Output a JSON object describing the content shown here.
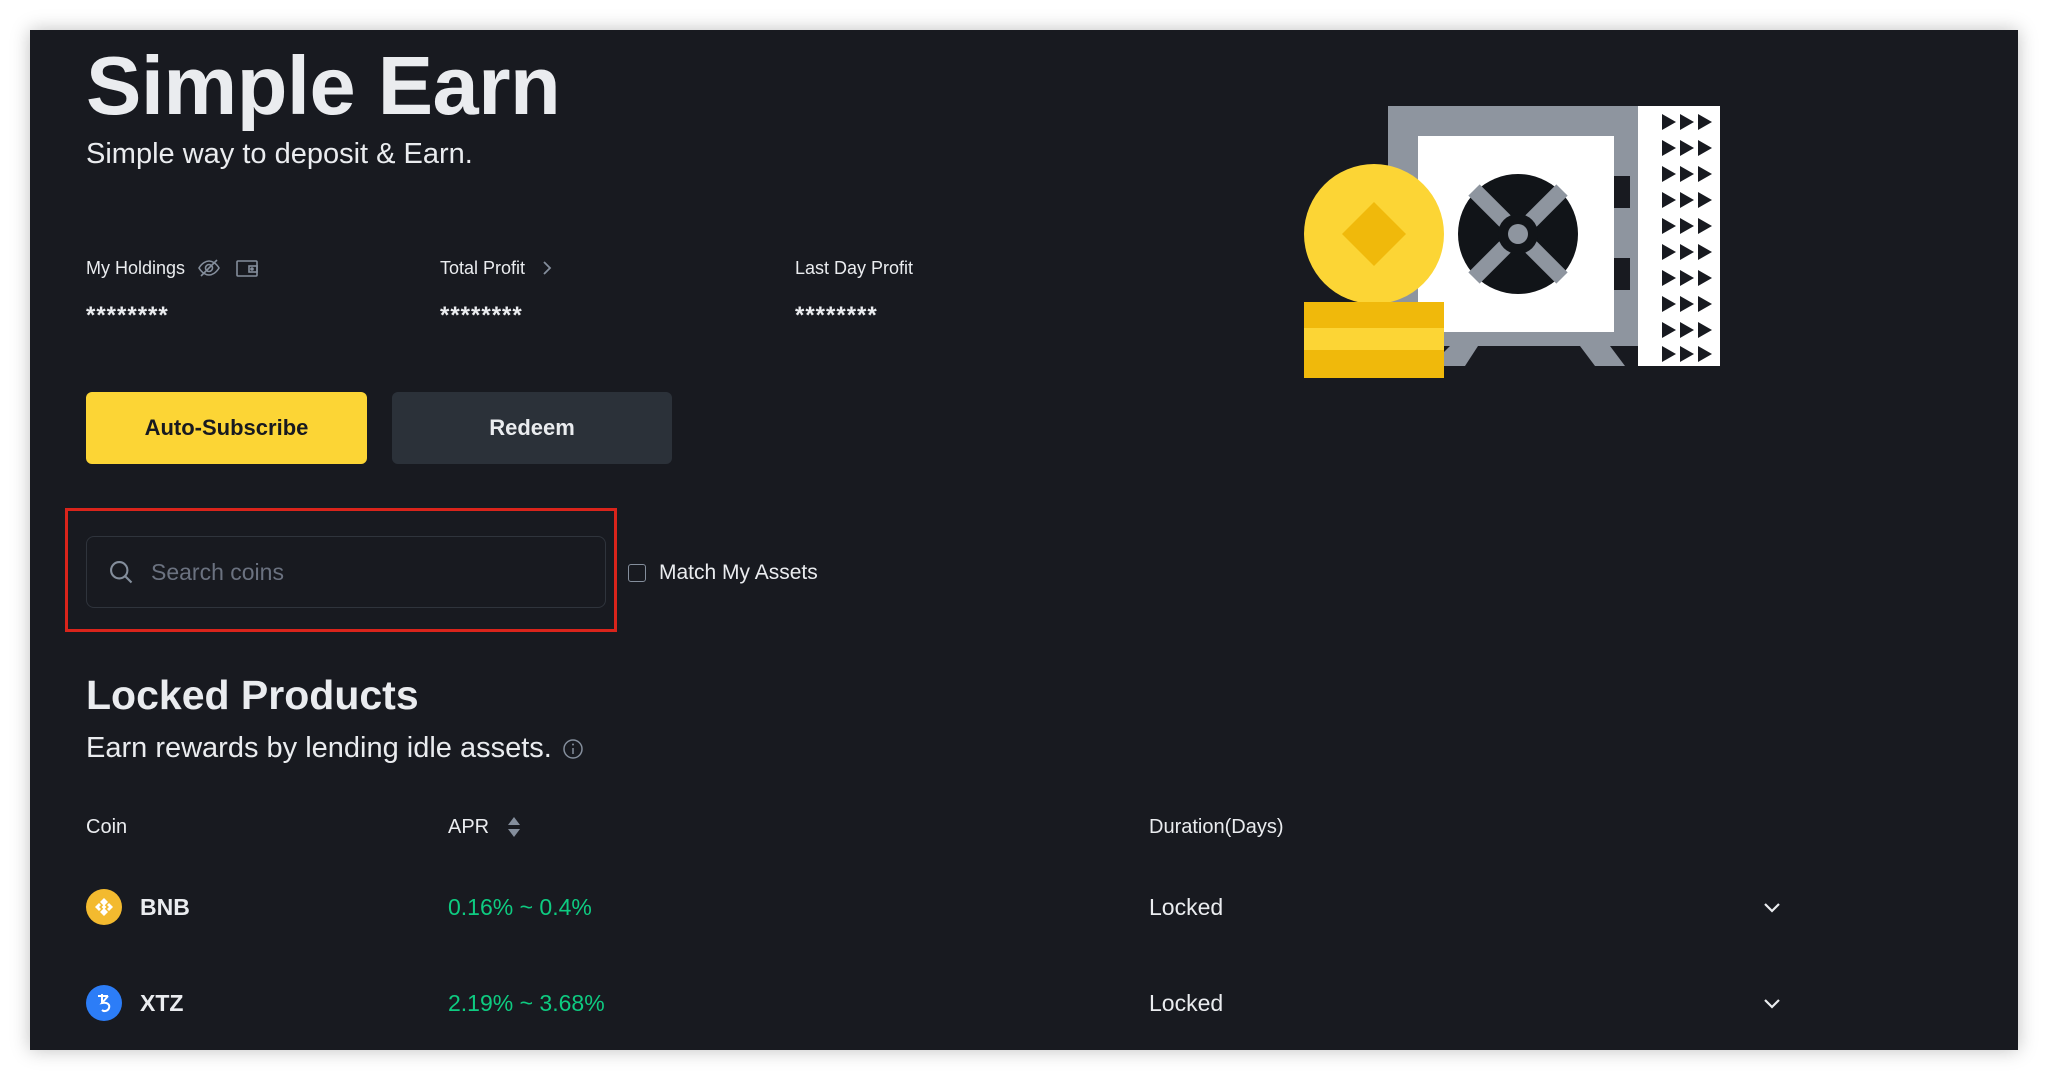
{
  "hero": {
    "title": "Simple Earn",
    "subtitle": "Simple way to deposit & Earn."
  },
  "stats": {
    "holdings": {
      "label": "My Holdings",
      "value": "********",
      "icons": [
        "eye-hidden-icon",
        "wallet-icon"
      ]
    },
    "total_profit": {
      "label": "Total Profit",
      "value": "********",
      "icons": [
        "chevron-right-icon"
      ]
    },
    "last_day_profit": {
      "label": "Last Day Profit",
      "value": "********"
    }
  },
  "actions": {
    "auto_subscribe": "Auto-Subscribe",
    "redeem": "Redeem"
  },
  "search": {
    "placeholder": "Search coins",
    "value": "",
    "match_assets_label": "Match My Assets",
    "match_assets_checked": false
  },
  "locked_products": {
    "title": "Locked Products",
    "subtitle": "Earn rewards by lending idle assets.",
    "columns": {
      "coin": "Coin",
      "apr": "APR",
      "duration": "Duration(Days)"
    },
    "rows": [
      {
        "coin": "BNB",
        "apr": "0.16% ~ 0.4%",
        "duration": "Locked",
        "icon_color": "#f3ba2f"
      },
      {
        "coin": "XTZ",
        "apr": "2.19% ~ 3.68%",
        "duration": "Locked",
        "icon_color": "#2c7df7"
      }
    ]
  },
  "colors": {
    "background": "#181a20",
    "primary": "#fcd535",
    "secondary_button": "#2b3139",
    "positive": "#0ecb81",
    "highlight": "#d9241b"
  }
}
